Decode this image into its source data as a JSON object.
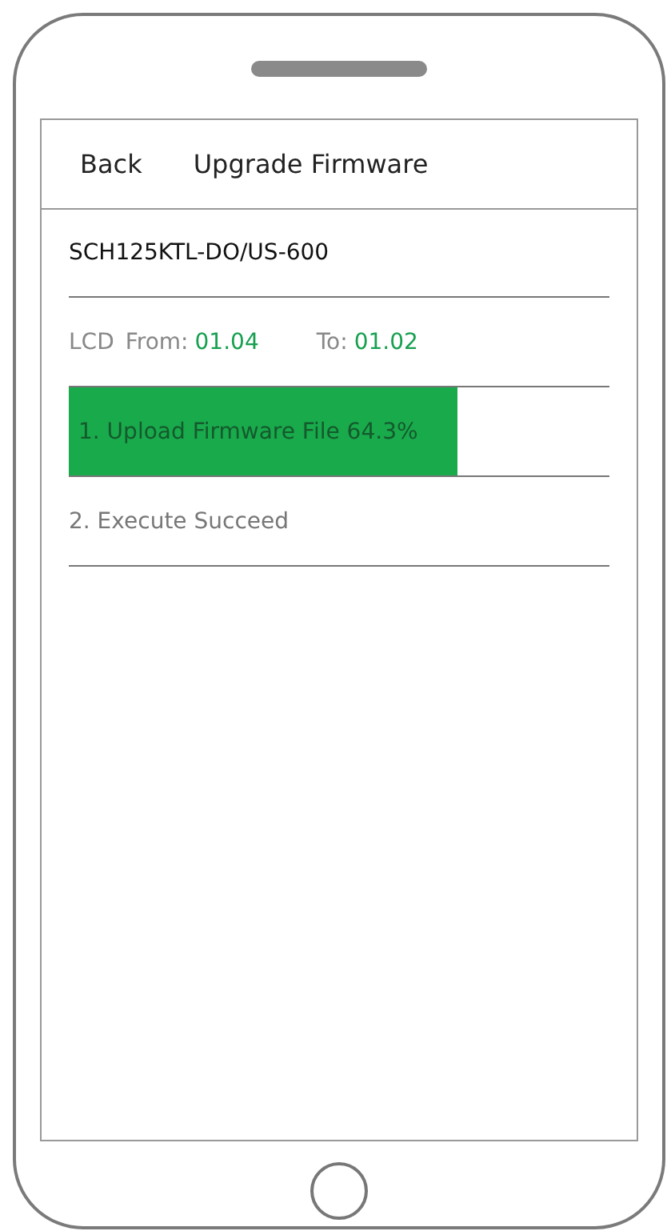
{
  "header": {
    "back": "Back",
    "title": "Upgrade Firmware"
  },
  "device": "SCH125KTL-DO/US-600",
  "version": {
    "label": "LCD",
    "from_label": "From:",
    "from": "01.04",
    "to_label": "To:",
    "to": "01.02"
  },
  "steps": [
    {
      "kind": "progress",
      "label": "1. Upload Firmware File 64.3%",
      "level": 0.72
    },
    {
      "kind": "plain",
      "label": "2. Execute Succeed"
    }
  ]
}
